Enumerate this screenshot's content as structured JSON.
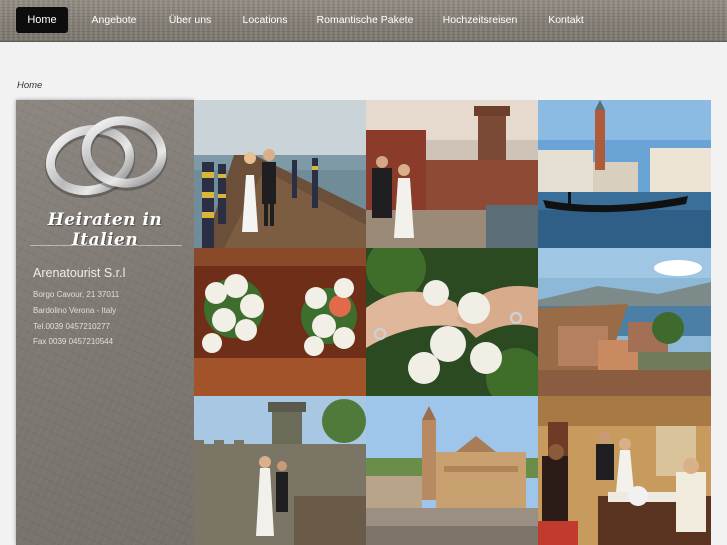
{
  "nav": {
    "items": [
      {
        "label": "Home",
        "active": true
      },
      {
        "label": "Angebote",
        "active": false
      },
      {
        "label": "Über uns",
        "active": false
      },
      {
        "label": "Locations",
        "active": false
      },
      {
        "label": "Romantische Pakete",
        "active": false
      },
      {
        "label": "Hochzeitsreisen",
        "active": false
      },
      {
        "label": "Kontakt",
        "active": false
      }
    ]
  },
  "breadcrumb": "Home",
  "sidebar": {
    "logo_text": "Heiraten in Italien",
    "company": "Arenatourist S.r.l",
    "address_lines": [
      "Borgo Cavour, 21 37011",
      "Bardolino Verona - Italy",
      "Tel.0039 0457210277",
      "Fax 0039 0457210544"
    ]
  },
  "gallery": [
    {
      "subject": "pier-couple-photo"
    },
    {
      "subject": "castle-couple-photo"
    },
    {
      "subject": "venice-gondola-photo"
    },
    {
      "subject": "bouquet-photo"
    },
    {
      "subject": "rings-hands-photo"
    },
    {
      "subject": "lake-garda-view-photo"
    },
    {
      "subject": "castle-tower-couple-photo"
    },
    {
      "subject": "cathedral-photo"
    },
    {
      "subject": "ceremony-hall-photo"
    }
  ],
  "colors": {
    "nav_active_bg": "#0d0d0d",
    "nav_text": "#ffffff",
    "page_bg": "#f2f2f2"
  }
}
